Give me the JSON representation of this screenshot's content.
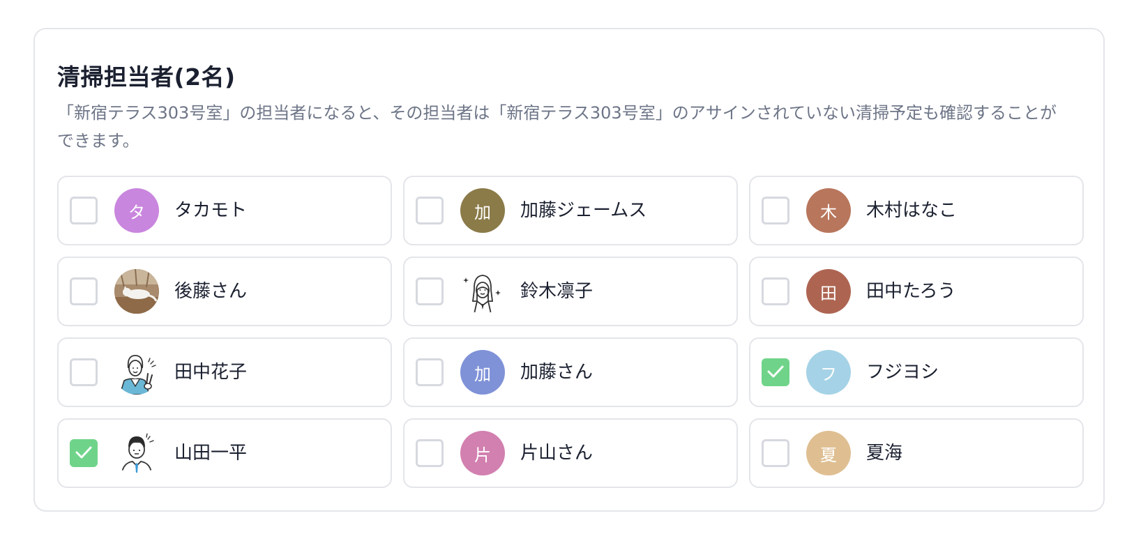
{
  "section": {
    "title": "清掃担当者(2名)",
    "description": "「新宿テラス303号室」の担当者になると、その担当者は「新宿テラス303号室」のアサインされていない清掃予定も確認することができます。"
  },
  "members": [
    {
      "name": "タカモト",
      "initial": "タ",
      "color": "#c986de",
      "checked": false,
      "avatar": "initial"
    },
    {
      "name": "加藤ジェームス",
      "initial": "加",
      "color": "#8b7b49",
      "checked": false,
      "avatar": "initial"
    },
    {
      "name": "木村はなこ",
      "initial": "木",
      "color": "#b8765c",
      "checked": false,
      "avatar": "initial"
    },
    {
      "name": "後藤さん",
      "initial": "",
      "color": "#a88a6c",
      "checked": false,
      "avatar": "cat-photo"
    },
    {
      "name": "鈴木凛子",
      "initial": "",
      "color": "#ffffff",
      "checked": false,
      "avatar": "woman-illustration"
    },
    {
      "name": "田中たろう",
      "initial": "田",
      "color": "#ad6552",
      "checked": false,
      "avatar": "initial"
    },
    {
      "name": "田中花子",
      "initial": "",
      "color": "#ffffff",
      "checked": false,
      "avatar": "woman-peace-illustration"
    },
    {
      "name": "加藤さん",
      "initial": "加",
      "color": "#7f92d8",
      "checked": false,
      "avatar": "initial"
    },
    {
      "name": "フジヨシ",
      "initial": "フ",
      "color": "#a5d2e6",
      "checked": true,
      "avatar": "initial"
    },
    {
      "name": "山田一平",
      "initial": "",
      "color": "#ffffff",
      "checked": true,
      "avatar": "man-illustration"
    },
    {
      "name": "片山さん",
      "initial": "片",
      "color": "#d280b0",
      "checked": false,
      "avatar": "initial"
    },
    {
      "name": "夏海",
      "initial": "夏",
      "color": "#dfbf92",
      "checked": false,
      "avatar": "initial"
    }
  ],
  "colors": {
    "checked": "#6fd48a",
    "border": "#e3e5ea",
    "description_text": "#6d7587"
  }
}
